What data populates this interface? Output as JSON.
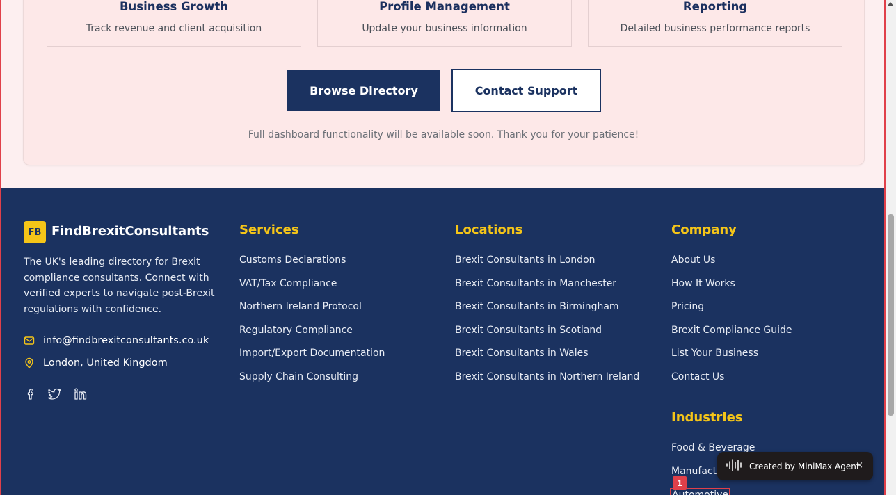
{
  "features": [
    {
      "title": "Business Growth",
      "desc": "Track revenue and client acquisition"
    },
    {
      "title": "Profile Management",
      "desc": "Update your business information"
    },
    {
      "title": "Reporting",
      "desc": "Detailed business performance reports"
    }
  ],
  "actions": {
    "browse_label": "Browse Directory",
    "support_label": "Contact Support"
  },
  "notice": "Full dashboard functionality will be available soon. Thank you for your patience!",
  "footer": {
    "logo_initials": "FB",
    "brand": "FindBrexitConsultants",
    "about": "The UK's leading directory for Brexit compliance consultants. Connect with verified experts to navigate post-Brexit regulations with confidence.",
    "email": "info@findbrexitconsultants.co.uk",
    "location": "London, United Kingdom",
    "social_icons": [
      "facebook-icon",
      "twitter-icon",
      "linkedin-icon"
    ],
    "services": {
      "heading": "Services",
      "items": [
        "Customs Declarations",
        "VAT/Tax Compliance",
        "Northern Ireland Protocol",
        "Regulatory Compliance",
        "Import/Export Documentation",
        "Supply Chain Consulting"
      ]
    },
    "locations": {
      "heading": "Locations",
      "items": [
        "Brexit Consultants in London",
        "Brexit Consultants in Manchester",
        "Brexit Consultants in Birmingham",
        "Brexit Consultants in Scotland",
        "Brexit Consultants in Wales",
        "Brexit Consultants in Northern Ireland"
      ]
    },
    "company": {
      "heading": "Company",
      "items": [
        "About Us",
        "How It Works",
        "Pricing",
        "Brexit Compliance Guide",
        "List Your Business",
        "Contact Us"
      ]
    },
    "industries": {
      "heading": "Industries",
      "items": [
        "Food & Beverage",
        "Manufacturing",
        "Automotive"
      ]
    }
  },
  "overlay": {
    "marker_number": "1",
    "badge_text": "Created by MiniMax Agent",
    "badge_close": "×"
  },
  "colors": {
    "navy": "#1b3260",
    "accent_yellow": "#f5c518",
    "highlight_red": "#e0404a"
  }
}
